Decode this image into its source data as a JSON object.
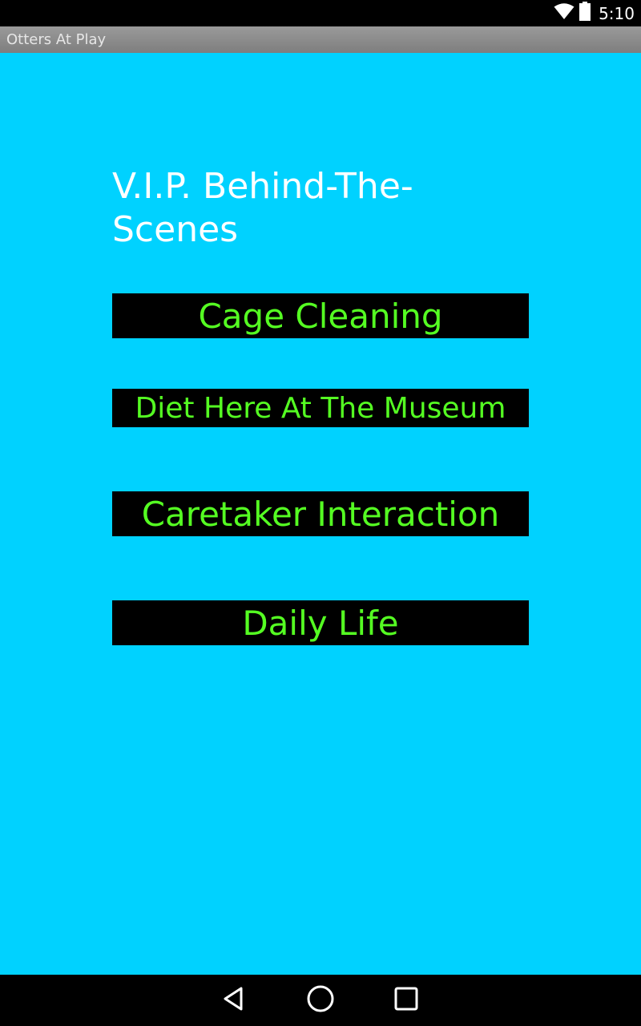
{
  "status_bar": {
    "time": "5:10",
    "icons": [
      "wifi-icon",
      "battery-icon"
    ]
  },
  "app": {
    "title": "Otters At Play"
  },
  "main": {
    "heading": "V.I.P. Behind-The-Scenes",
    "buttons": [
      {
        "label": "Cage Cleaning"
      },
      {
        "label": "Diet Here At The Museum"
      },
      {
        "label": "Caretaker Interaction"
      },
      {
        "label": "Daily Life"
      }
    ]
  },
  "nav_bar": {
    "icons": [
      "back-icon",
      "home-icon",
      "recents-icon"
    ]
  },
  "colors": {
    "background": "#00d2ff",
    "button_bg": "#000000",
    "button_text": "#55ff22",
    "heading_text": "#ffffff"
  }
}
